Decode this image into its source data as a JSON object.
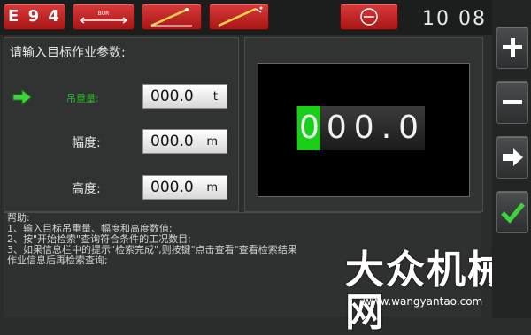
{
  "topbar": {
    "buttons": [
      {
        "label": "E 9 4",
        "name": "e94-button"
      },
      {
        "label": "",
        "name": "boom-length-button",
        "icon": "boom-length-icon"
      },
      {
        "label": "",
        "name": "boom-angle-button",
        "icon": "boom-angle-icon"
      },
      {
        "label": "",
        "name": "jib-angle-button",
        "icon": "jib-angle-icon"
      },
      {
        "label": "",
        "name": "stop-button",
        "icon": "stop-icon"
      }
    ],
    "clock_hour": "10",
    "clock_minute": "08"
  },
  "left_panel": {
    "prompt": "请输入目标作业参数:",
    "params": [
      {
        "label": "吊重量:",
        "value": "000.0",
        "unit": "t",
        "active": true
      },
      {
        "label": "幅度:",
        "value": "000.0",
        "unit": "m",
        "active": false
      },
      {
        "label": "高度:",
        "value": "000.0",
        "unit": "m",
        "active": false
      }
    ]
  },
  "display": {
    "cursor_digit": "0",
    "rest_digits": "00.0"
  },
  "help": {
    "title": "帮助:",
    "lines": [
      "1、输入目标吊重量、幅度和高度数值;",
      "2、按\"开始检索\"查询符合条件的工况数目;",
      "3、如果信息栏中的提示\"检索完成\",则按键\"点击查看\"查看检索结果",
      "作业信息后再检索查询;"
    ]
  },
  "right_buttons": [
    {
      "name": "plus-button",
      "icon": "plus-icon"
    },
    {
      "name": "minus-button",
      "icon": "minus-icon"
    },
    {
      "name": "next-button",
      "icon": "arrow-right-icon"
    },
    {
      "name": "confirm-button",
      "icon": "check-icon"
    }
  ],
  "watermark": {
    "text": "大众机械网",
    "url": "www.wangyantao.com"
  },
  "colors": {
    "button_red": "#c92424",
    "active_green": "#2fb22f",
    "cursor_green": "#18d018",
    "background": "#2b2d2d"
  }
}
